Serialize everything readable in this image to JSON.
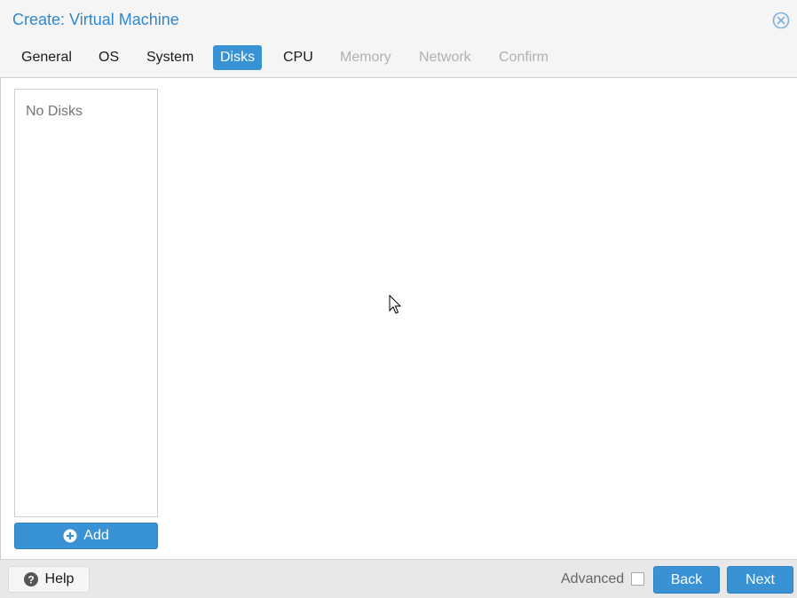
{
  "window": {
    "title": "Create: Virtual Machine",
    "close_icon": "close-circle-icon"
  },
  "tabs": [
    {
      "label": "General",
      "state": "normal"
    },
    {
      "label": "OS",
      "state": "normal"
    },
    {
      "label": "System",
      "state": "normal"
    },
    {
      "label": "Disks",
      "state": "active"
    },
    {
      "label": "CPU",
      "state": "normal"
    },
    {
      "label": "Memory",
      "state": "disabled"
    },
    {
      "label": "Network",
      "state": "disabled"
    },
    {
      "label": "Confirm",
      "state": "disabled"
    }
  ],
  "disks": {
    "empty_text": "No Disks",
    "add_label": "Add",
    "add_icon": "plus-circle-icon"
  },
  "footer": {
    "help_label": "Help",
    "help_icon": "question-circle-icon",
    "advanced_label": "Advanced",
    "advanced_checked": false,
    "back_label": "Back",
    "next_label": "Next"
  },
  "colors": {
    "accent": "#3892d4",
    "title": "#2f88d0",
    "disabled_text": "#b0b0b0"
  }
}
